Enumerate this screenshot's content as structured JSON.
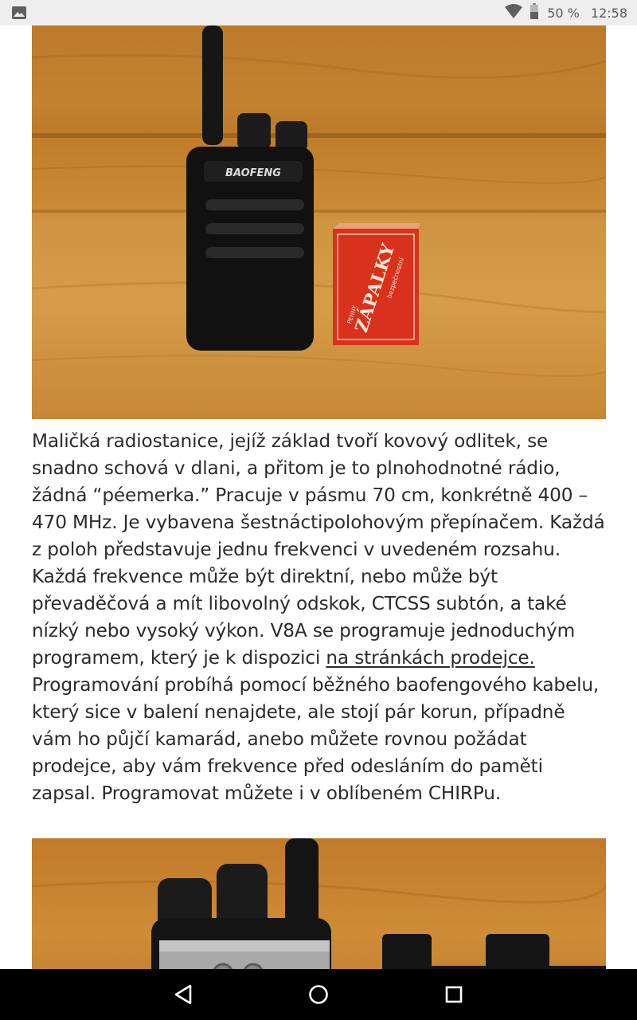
{
  "status_bar": {
    "notification_icon": "image-icon",
    "wifi_icon": "wifi-icon",
    "battery_icon": "battery-icon",
    "battery": "50 %",
    "time": "12:58"
  },
  "article": {
    "image1_brand": "BAOFENG",
    "image1_box_text": "ZÁPALKY",
    "image1_box_small": "PENNY.",
    "image1_box_sub": "bezpečnostní",
    "paragraph_before_link": "Maličká radiostanice, jejíž základ tvoří kovový odlitek, se snadno schová v dlani, a přitom je to plnohodnotné rádio, žádná “péemerka.” Pracuje v pásmu 70 cm, konkrétně 400 – 470 MHz. Je vybavena šestnáctipolohovým přepínačem. Každá z poloh představuje jednu frekvenci v uvedeném rozsahu. Každá frekvence může být direktní, nebo může být převaděčová a mít libovolný odskok, CTCSS subtón, a také nízký nebo vysoký výkon. V8A se programuje jednoduchým programem, který je k dispozici ",
    "link_text": "na stránkách prodejce.",
    "paragraph_after_link": " Programování probíhá pomocí běžného baofengového kabelu, který sice v balení nenajdete, ale stojí pár korun, případně vám ho půjčí kamarád, anebo můžete rovnou požádat prodejce, aby vám frekvence před odesláním do paměti zapsal. Programovat můžete i v oblíbeném CHIRPu."
  },
  "nav_bar": {
    "back_icon": "back-triangle-icon",
    "home_icon": "home-circle-icon",
    "recents_icon": "recents-square-icon"
  },
  "colors": {
    "status_bar_bg": "#eeeeee",
    "nav_bar_bg": "#000000",
    "text": "#2b2b2b",
    "wood": "#c98a34",
    "matchbox": "#d8321c"
  }
}
